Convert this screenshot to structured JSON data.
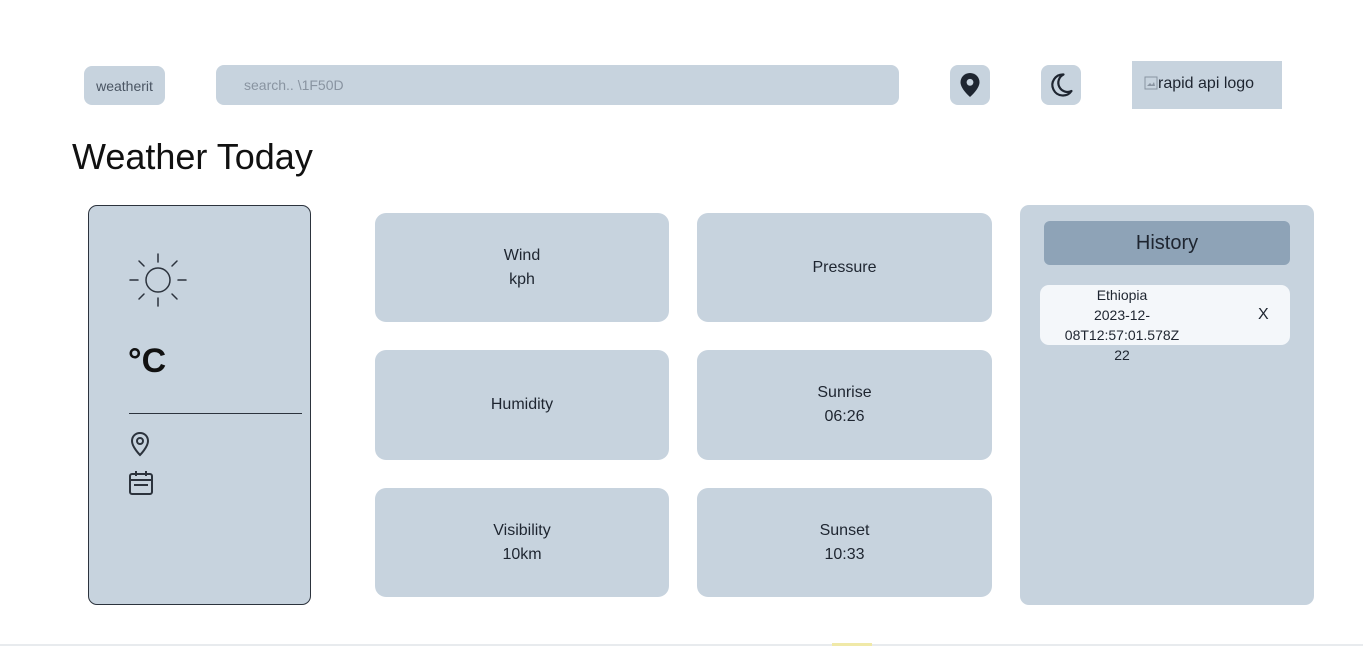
{
  "header": {
    "brand": "weatherit",
    "search_placeholder": "search.. \\1F50D",
    "location_icon": "location-pin-icon",
    "theme_icon": "moon-icon",
    "logo_alt": "rapid api logo"
  },
  "page_title": "Weather Today",
  "today": {
    "weather_icon": "sun-icon",
    "temperature": "°C",
    "location_icon": "map-pin-icon",
    "date_icon": "calendar-icon"
  },
  "stats": [
    {
      "label": "Wind",
      "value": "kph"
    },
    {
      "label": "Pressure",
      "value": ""
    },
    {
      "label": "Humidity",
      "value": ""
    },
    {
      "label": "Sunrise",
      "value": "06:26"
    },
    {
      "label": "Visibility",
      "value": "10km"
    },
    {
      "label": "Sunset",
      "value": "10:33"
    }
  ],
  "history": {
    "title": "History",
    "items": [
      {
        "location": "Ethiopia",
        "timestamp": "2023-12-08T12:57:01.578Z",
        "temp": "22",
        "remove": "X"
      }
    ]
  },
  "colors": {
    "panel": "#c7d3de",
    "history_header": "#8ea3b7",
    "history_item": "#f4f7fa",
    "text": "#1e2530"
  }
}
